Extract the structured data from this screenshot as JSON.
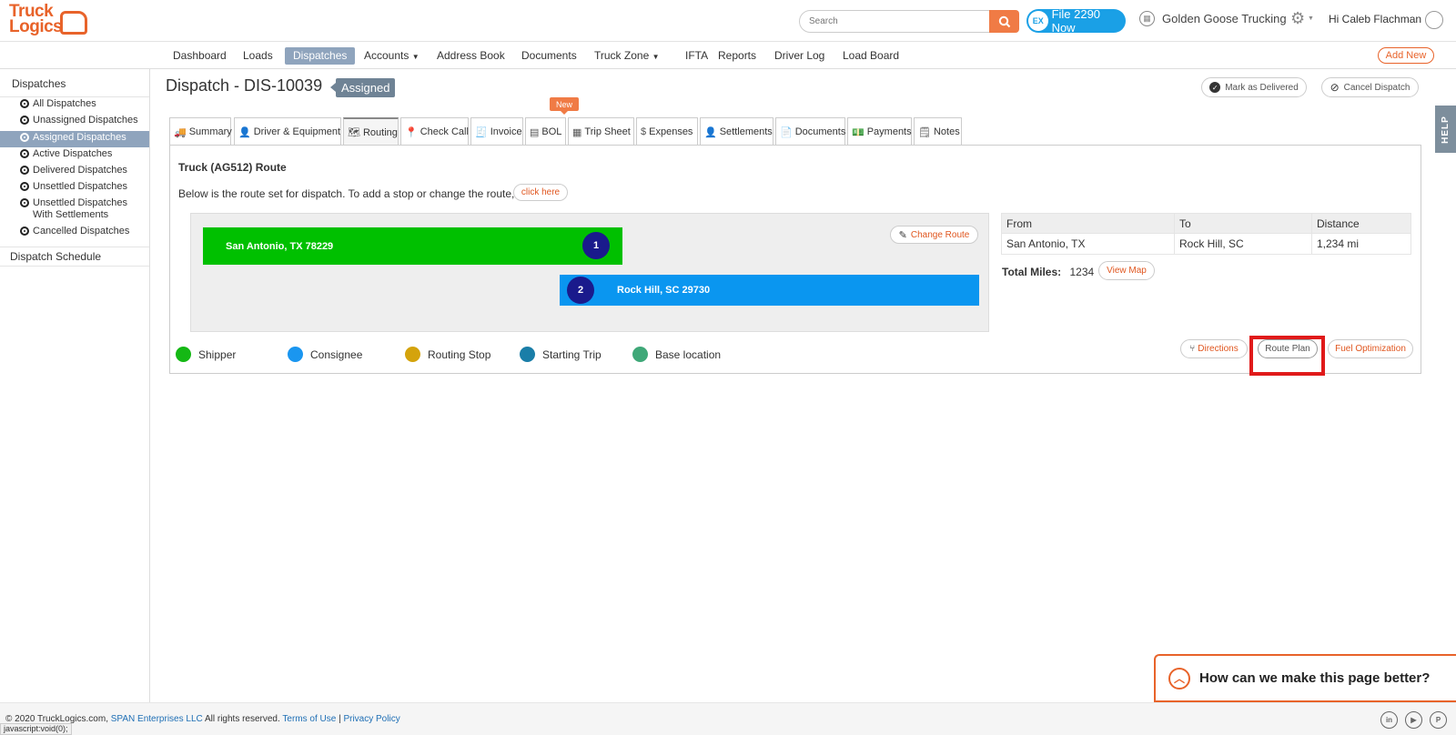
{
  "header": {
    "logo_line1": "Truck",
    "logo_line2": "Logics",
    "search_placeholder": "Search",
    "file_btn_label": "File 2290 Now",
    "file_btn_icon_text": "EX",
    "company": "Golden Goose Trucking",
    "greeting": "Hi Caleb Flachman"
  },
  "nav": {
    "items": [
      "Dashboard",
      "Loads",
      "Dispatches",
      "Accounts",
      "Address Book",
      "Documents",
      "Truck Zone",
      "IFTA",
      "Reports",
      "Driver Log",
      "Load Board"
    ],
    "active": "Dispatches",
    "add_new": "Add New"
  },
  "sidebar": {
    "heading": "Dispatches",
    "items": [
      {
        "label": "All Dispatches"
      },
      {
        "label": "Unassigned Dispatches"
      },
      {
        "label": "Assigned Dispatches"
      },
      {
        "label": "Active Dispatches"
      },
      {
        "label": "Delivered Dispatches"
      },
      {
        "label": "Unsettled Dispatches"
      },
      {
        "label": "Unsettled Dispatches With Settlements"
      },
      {
        "label": "Cancelled Dispatches"
      }
    ],
    "active_index": 2,
    "schedule": "Dispatch Schedule"
  },
  "page": {
    "title": "Dispatch - DIS-10039",
    "status": "Assigned",
    "mark_delivered": "Mark as Delivered",
    "cancel_dispatch": "Cancel Dispatch",
    "help": "HELP"
  },
  "tabs": {
    "items": [
      "Summary",
      "Driver & Equipment",
      "Routing",
      "Check Call",
      "Invoice",
      "BOL",
      "Trip Sheet",
      "Expenses",
      "Settlements",
      "Documents",
      "Payments",
      "Notes"
    ],
    "active": "Routing",
    "new_badge": "New"
  },
  "routing": {
    "title": "Truck (AG512) Route",
    "description": "Below is the route set for dispatch. To add a stop or change the route,",
    "click_here": "click here",
    "change_route": "Change Route",
    "stops": [
      {
        "number": "1",
        "label": "San Antonio, TX 78229",
        "color": "#00c000"
      },
      {
        "number": "2",
        "label": "Rock Hill, SC 29730",
        "color": "#0a96f0"
      }
    ],
    "legend": [
      {
        "label": "Shipper",
        "color": "#14b814"
      },
      {
        "label": "Consignee",
        "color": "#1a96f0"
      },
      {
        "label": "Routing Stop",
        "color": "#d4a30c"
      },
      {
        "label": "Starting Trip",
        "color": "#1a7ea8"
      },
      {
        "label": "Base location",
        "color": "#3fa878"
      }
    ],
    "table": {
      "headers": [
        "From",
        "To",
        "Distance"
      ],
      "row": [
        "San Antonio, TX",
        "Rock Hill, SC",
        "1,234 mi"
      ]
    },
    "total_miles_label": "Total Miles:",
    "total_miles_value": "1234",
    "view_map": "View Map",
    "directions": "Directions",
    "route_plan": "Route Plan",
    "fuel_optimization": "Fuel Optimization"
  },
  "feedback": {
    "text": "How can we make this page better?"
  },
  "footer": {
    "copyright": "© 2020 TruckLogics.com,",
    "company_link": "SPAN Enterprises LLC",
    "rights": "All rights reserved.",
    "terms": "Terms of Use",
    "privacy": "Privacy Policy",
    "status_url": "javascript:void(0);"
  }
}
